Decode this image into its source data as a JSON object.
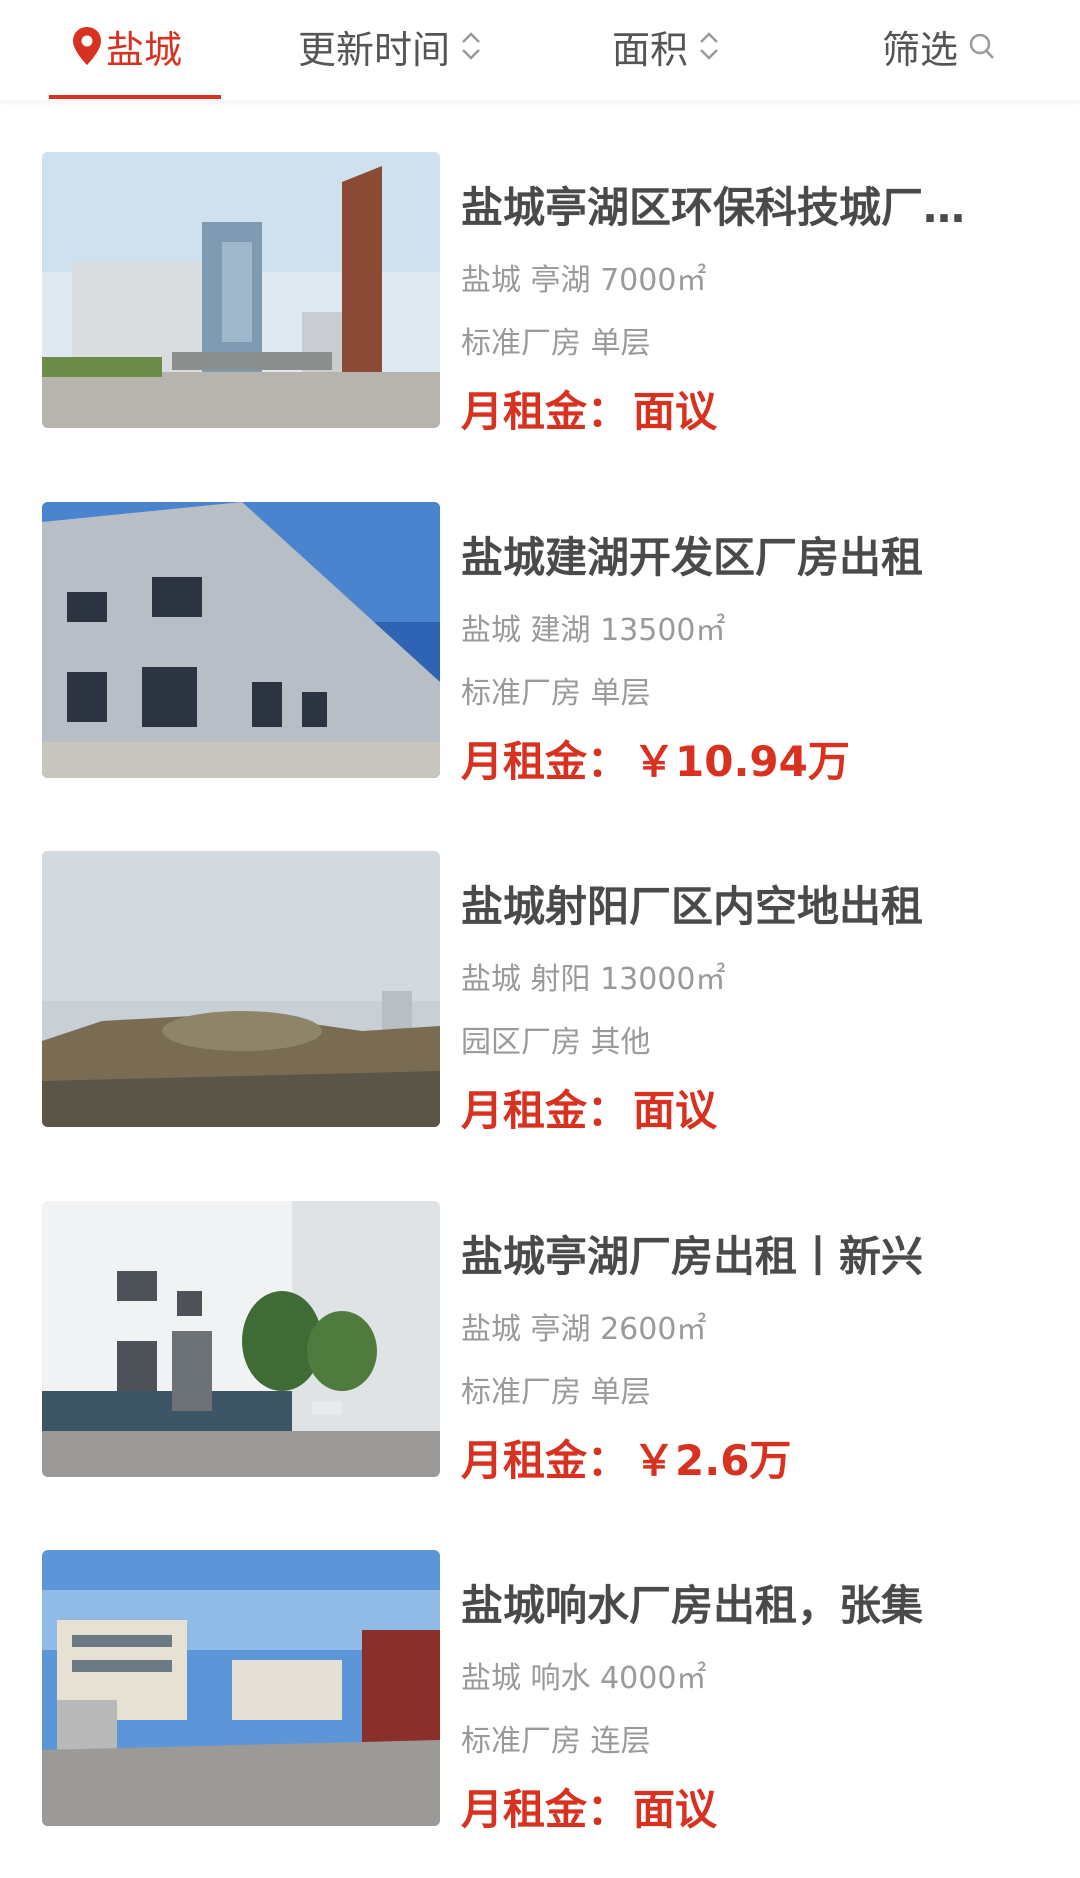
{
  "filters": {
    "city": "盐城",
    "update_time": "更新时间",
    "area": "面积",
    "filter": "筛选"
  },
  "colors": {
    "accent": "#d8311f",
    "title": "#4a4a4a",
    "meta": "#9a9a9a"
  },
  "listings": [
    {
      "title": "盐城亭湖区环保科技城厂房出租",
      "location": "盐城 亭湖 7000㎡",
      "type": "标准厂房 单层",
      "price_label": "月租金：",
      "price": "面议",
      "image": "factory-office-building-photo"
    },
    {
      "title": "盐城建湖开发区厂房出租",
      "location": "盐城 建湖 13500㎡",
      "type": "标准厂房 单层",
      "price_label": "月租金：",
      "price": "￥10.94万",
      "image": "steel-workshop-photo"
    },
    {
      "title": "盐城射阳厂区内空地出租",
      "location": "盐城 射阳 13000㎡",
      "type": "园区厂房 其他",
      "price_label": "月租金：",
      "price": "面议",
      "image": "empty-land-photo"
    },
    {
      "title": "盐城亭湖厂房出租丨新兴",
      "location": "盐城 亭湖 2600㎡",
      "type": "标准厂房 单层",
      "price_label": "月租金：",
      "price": "￥2.6万",
      "image": "white-workshop-photo"
    },
    {
      "title": "盐城响水厂房出租，张集",
      "location": "盐城 响水 4000㎡",
      "type": "标准厂房 连层",
      "price_label": "月租金：",
      "price": "面议",
      "image": "industrial-park-road-photo"
    }
  ]
}
